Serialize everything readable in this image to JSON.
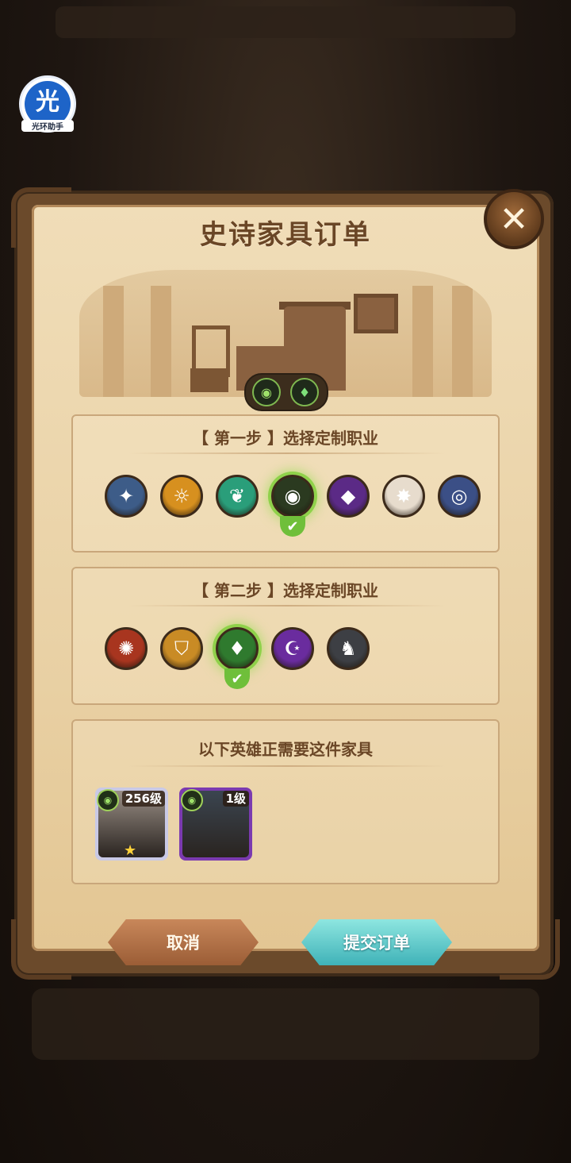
{
  "helper": {
    "glyph": "光",
    "caption": "光环助手"
  },
  "dialog": {
    "title": "史诗家具订单",
    "close_label": "✕"
  },
  "step1": {
    "title": "【 第一步 】选择定制职业",
    "selected_index": 3,
    "options": [
      {
        "name": "star-compass-icon",
        "glyph": "✦",
        "color": "#3d5c88"
      },
      {
        "name": "sun-keyhole-icon",
        "glyph": "☼",
        "color": "#d7901f"
      },
      {
        "name": "leaf-icon",
        "glyph": "❦",
        "color": "#2a9e7a"
      },
      {
        "name": "green-eye-icon",
        "glyph": "◉",
        "color": "#2b3a20"
      },
      {
        "name": "purple-crystal-icon",
        "glyph": "◆",
        "color": "#5b2a86"
      },
      {
        "name": "white-star-icon",
        "glyph": "✸",
        "color": "#e7dccd"
      },
      {
        "name": "blue-orb-icon",
        "glyph": "◎",
        "color": "#3b4f86"
      }
    ]
  },
  "step2": {
    "title": "【 第二步 】选择定制职业",
    "selected_index": 2,
    "options": [
      {
        "name": "red-flame-icon",
        "glyph": "✺",
        "color": "#a8351f"
      },
      {
        "name": "gold-shield-icon",
        "glyph": "⛉",
        "color": "#c98b25"
      },
      {
        "name": "green-crystal-icon",
        "glyph": "♦",
        "color": "#2f7a2e"
      },
      {
        "name": "purple-swirl-icon",
        "glyph": "☪",
        "color": "#6a2c9e"
      },
      {
        "name": "gray-horned-icon",
        "glyph": "♞",
        "color": "#3d3f44"
      }
    ]
  },
  "heroes": {
    "title": "以下英雄正需要这件家具",
    "items": [
      {
        "level": "256级",
        "stars": "★",
        "frame": "#c9c9e6",
        "portrait": "#9a8f86"
      },
      {
        "level": "1级",
        "stars": "",
        "frame": "#7b3ab0",
        "portrait": "#3b4550"
      }
    ]
  },
  "buttons": {
    "cancel": "取消",
    "submit": "提交订单"
  },
  "scene_pill": {
    "left_icon": "green-eye-icon",
    "right_icon": "green-crystal-icon"
  }
}
